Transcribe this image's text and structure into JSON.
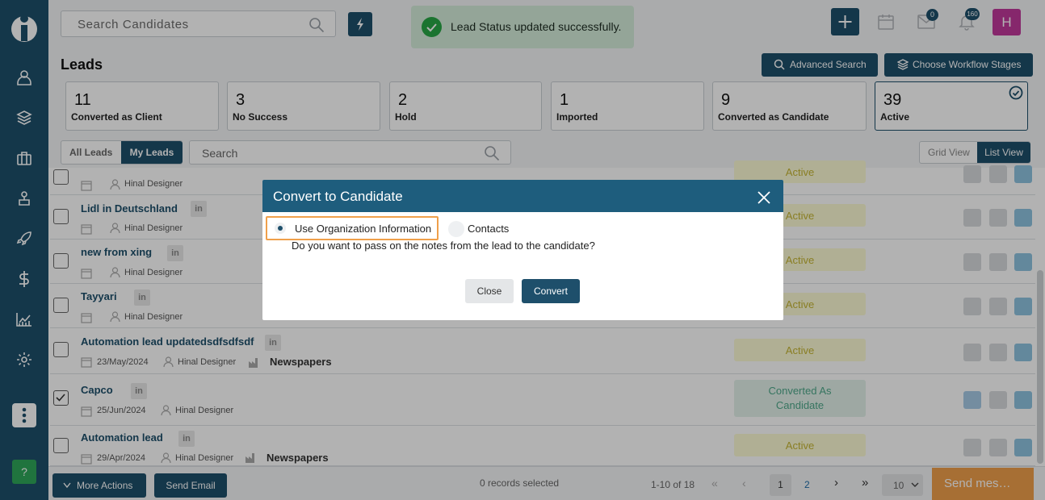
{
  "header": {
    "search_placeholder": "Search Candidates",
    "messages_badge": "0",
    "notifications_badge": "160",
    "avatar_initial": "H"
  },
  "toast": {
    "message": "Lead Status updated successfully."
  },
  "page": {
    "title": "Leads",
    "advanced_search": "Advanced Search",
    "workflow": "Choose Workflow Stages"
  },
  "summary_cards": [
    {
      "count": "11",
      "label": "Converted as Client"
    },
    {
      "count": "3",
      "label": "No Success"
    },
    {
      "count": "2",
      "label": "Hold"
    },
    {
      "count": "1",
      "label": "Imported"
    },
    {
      "count": "9",
      "label": "Converted as Candidate"
    },
    {
      "count": "39",
      "label": "Active"
    }
  ],
  "filters": {
    "all_leads": "All Leads",
    "my_leads": "My Leads",
    "search_placeholder": "Search",
    "grid_view": "Grid View",
    "list_view": "List View"
  },
  "rows": [
    {
      "name": "",
      "date": "",
      "owner": "Hinal Designer",
      "source": "",
      "status": "Active"
    },
    {
      "name": "Lidl in Deutschland",
      "date": "",
      "owner": "Hinal Designer",
      "source": "",
      "status": "Active"
    },
    {
      "name": "new from xing",
      "date": "",
      "owner": "Hinal Designer",
      "source": "",
      "status": "Active"
    },
    {
      "name": "Tayyari",
      "date": "",
      "owner": "Hinal Designer",
      "source": "",
      "status": "Active"
    },
    {
      "name": "Automation lead updatedsdfsdfsdf",
      "date": "23/May/2024",
      "owner": "Hinal Designer",
      "source": "Newspapers",
      "status": "Active"
    },
    {
      "name": "Capco",
      "date": "25/Jun/2024",
      "owner": "Hinal Designer",
      "source": "",
      "status": "Converted As Candidate"
    },
    {
      "name": "Automation lead",
      "date": "29/Apr/2024",
      "owner": "Hinal Designer",
      "source": "Newspapers",
      "status": "Active"
    }
  ],
  "modal": {
    "title": "Convert to Candidate",
    "option_org": "Use Organization Information",
    "option_contacts": "Contacts",
    "question": "Do you want to pass on the notes from the lead to the candidate?",
    "close": "Close",
    "convert": "Convert"
  },
  "footer": {
    "more_actions": "More Actions",
    "send_email": "Send Email",
    "records_selected": "0 records selected",
    "range": "1-10 of 18",
    "page1": "1",
    "page2": "2",
    "page_size": "10",
    "send_message": "Send mes…"
  },
  "colors": {
    "primary": "#1e4f6b",
    "toast_bg": "#d4edda",
    "accent_orange": "#f0a04b",
    "avatar": "#c0399b"
  }
}
